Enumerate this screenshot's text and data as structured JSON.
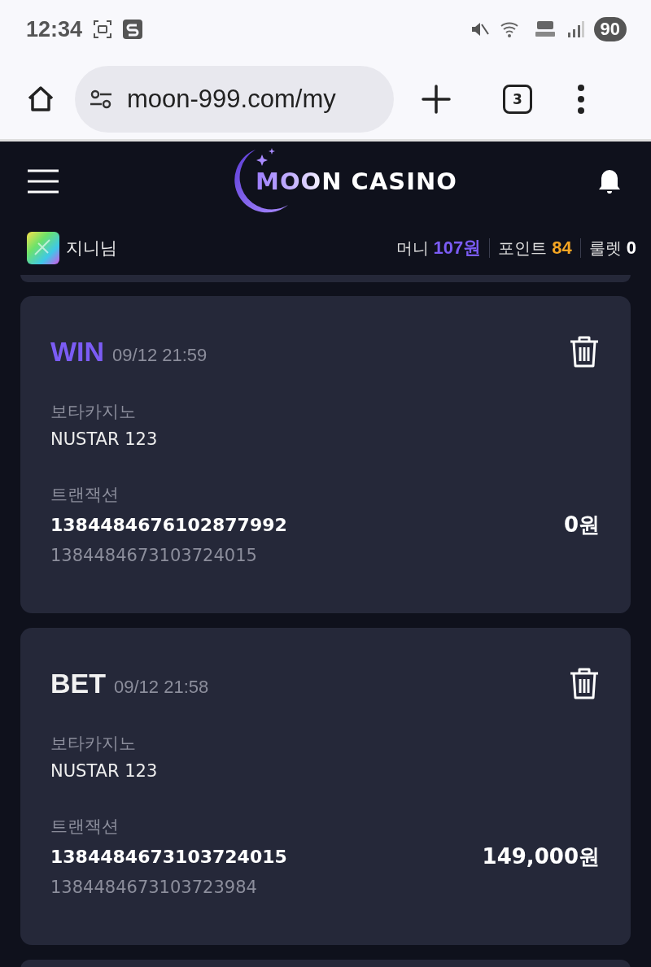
{
  "status_bar": {
    "time": "12:34",
    "battery": "90"
  },
  "browser": {
    "url": "moon-999.com/my",
    "tab_count": "3"
  },
  "header": {
    "logo": "MOON CASINO"
  },
  "user": {
    "name": "지니님",
    "stats": [
      {
        "label": "머니",
        "value": "107원",
        "color": "#7b5cf5"
      },
      {
        "label": "포인트",
        "value": "84",
        "color": "#f5a623"
      },
      {
        "label": "룰렛",
        "value": "0",
        "color": "#ffffff"
      }
    ]
  },
  "records": [
    {
      "kind": "win",
      "type": "WIN",
      "time": "09/12 21:59",
      "game_label": "보타카지노",
      "game": "NUSTAR 123",
      "tx_label": "트랜잭션",
      "tx_id": "1384484676102877992",
      "ref_id": "1384484673103724015",
      "amount": "0원"
    },
    {
      "kind": "bet",
      "type": "BET",
      "time": "09/12 21:58",
      "game_label": "보타카지노",
      "game": "NUSTAR 123",
      "tx_label": "트랜잭션",
      "tx_id": "1384484673103724015",
      "ref_id": "1384484673103723984",
      "amount": "149,000원"
    }
  ]
}
